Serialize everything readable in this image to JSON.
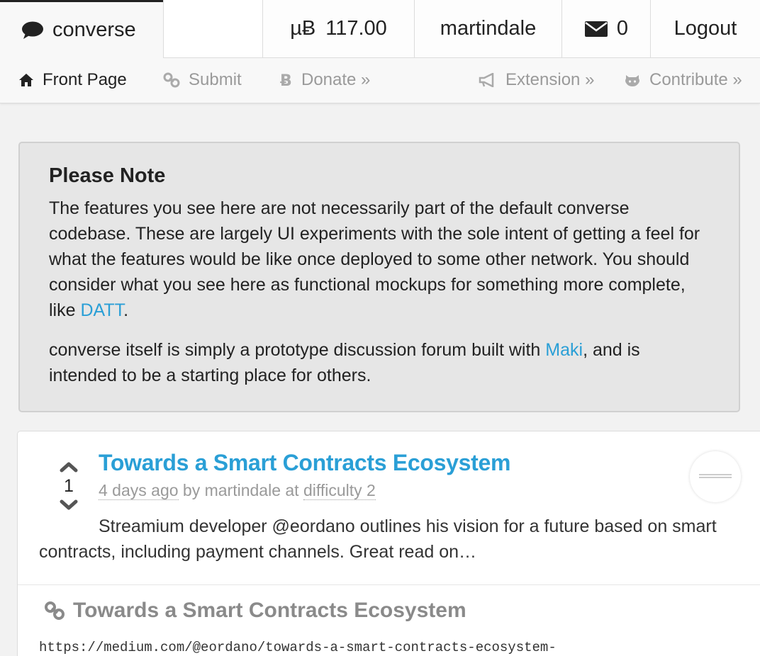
{
  "header": {
    "brand": "converse",
    "balance": "117.00",
    "balance_unit": "µɃ",
    "username": "martindale",
    "message_count": "0",
    "logout": "Logout"
  },
  "nav": {
    "front_page": "Front Page",
    "submit": "Submit",
    "donate": "Donate »",
    "extension": "Extension »",
    "contribute": "Contribute »"
  },
  "note": {
    "heading": "Please Note",
    "p1_text": "The features you see here are not necessarily part of the default converse codebase. These are largely UI experiments with the sole intent of getting a feel for what the features would be like once deployed to some other network. You should consider what you see here as functional mockups for something more complete, like ",
    "p1_link": "DATT",
    "p1_end": ".",
    "p2_text": "converse itself is simply a prototype discussion forum built with ",
    "p2_link": "Maki",
    "p2_end": ", and is intended to be a starting place for others."
  },
  "post": {
    "title": "Towards a Smart Contracts Ecosystem",
    "score": "1",
    "age": "4 days ago",
    "by_label": "by",
    "author": "martindale",
    "at_label": "at",
    "difficulty": "difficulty 2",
    "description": "Streamium developer @eordano outlines his vision for a future based on smart contracts, including payment channels. Great read on…",
    "link_title": "Towards a Smart Contracts Ecosystem",
    "link_url": "https://medium.com/@eordano/towards-a-smart-contracts-ecosystem-"
  },
  "colors": {
    "accent": "#2a9fd6",
    "muted": "#9a9a9a",
    "note_bg": "#e6e6e6"
  },
  "icons": {
    "brand": "comment-icon",
    "balance": "bitcoin-icon",
    "mail": "envelope-icon",
    "front_page": "home-icon",
    "submit": "link-icon",
    "donate": "bitcoin-icon",
    "extension": "bullhorn-icon",
    "contribute": "github-icon",
    "upvote": "chevron-up-icon",
    "downvote": "chevron-down-icon"
  }
}
